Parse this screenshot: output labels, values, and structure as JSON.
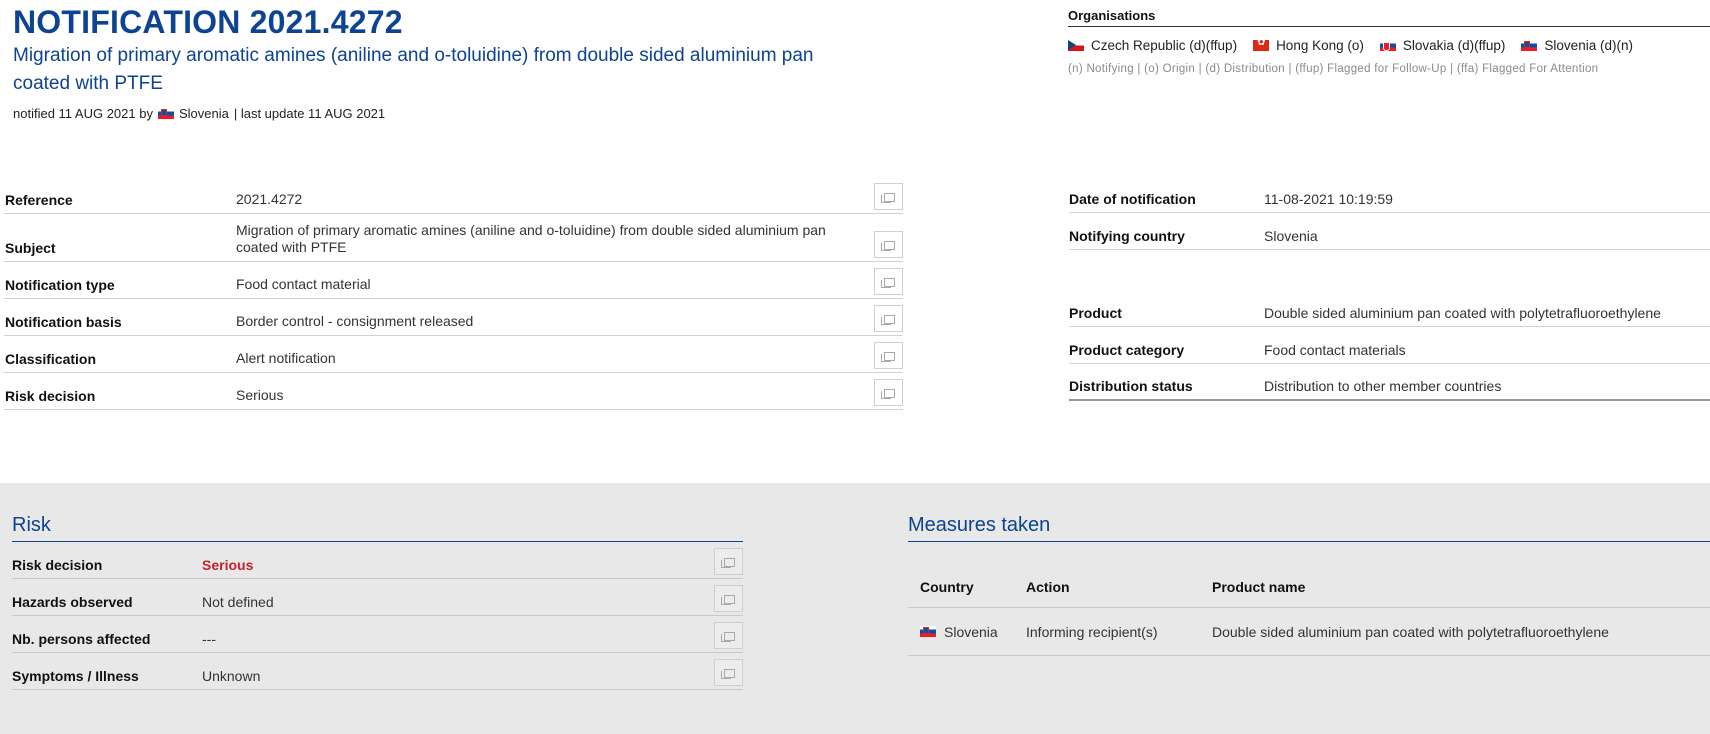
{
  "header": {
    "title": "NOTIFICATION 2021.4272",
    "subtitle": "Migration of primary aromatic amines (aniline and o-toluidine) from double sided aluminium pan coated with PTFE",
    "notified_prefix": "notified 11 AUG 2021 by",
    "notified_country": "Slovenia",
    "last_update": "| last update 11 AUG 2021"
  },
  "organisations": {
    "title": "Organisations",
    "items": [
      {
        "flag": "cz",
        "label": "Czech Republic (d)(ffup)"
      },
      {
        "flag": "hk",
        "label": "Hong Kong (o)"
      },
      {
        "flag": "sk",
        "label": "Slovakia (d)(ffup)"
      },
      {
        "flag": "si",
        "label": "Slovenia (d)(n)"
      }
    ],
    "legend": "(n) Notifying | (o) Origin | (d) Distribution | (ffup) Flagged for Follow-Up | (ffa) Flagged For Attention"
  },
  "details": [
    {
      "label": "Reference",
      "value": "2021.4272"
    },
    {
      "label": "Subject",
      "value": "Migration of primary aromatic amines (aniline and o-toluidine) from double sided aluminium pan coated with PTFE"
    },
    {
      "label": "Notification type",
      "value": "Food contact material"
    },
    {
      "label": "Notification basis",
      "value": "Border control - consignment released"
    },
    {
      "label": "Classification",
      "value": "Alert notification"
    },
    {
      "label": "Risk decision",
      "value": "Serious"
    }
  ],
  "right_details": {
    "date_label": "Date of notification",
    "date_value": "11-08-2021 10:19:59",
    "country_label": "Notifying country",
    "country_value": "Slovenia",
    "product_label": "Product",
    "product_value": "Double sided aluminium pan coated with polytetrafluoroethylene",
    "category_label": "Product category",
    "category_value": "Food contact materials",
    "distribution_label": "Distribution status",
    "distribution_value": "Distribution to other member countries"
  },
  "risk": {
    "title": "Risk",
    "rows": [
      {
        "label": "Risk decision",
        "value": "Serious"
      },
      {
        "label": "Hazards observed",
        "value": "Not defined"
      },
      {
        "label": "Nb. persons affected",
        "value": "---"
      },
      {
        "label": "Symptoms / Illness",
        "value": "Unknown"
      }
    ]
  },
  "measures": {
    "title": "Measures taken",
    "columns": [
      "Country",
      "Action",
      "Product name"
    ],
    "rows": [
      {
        "country": "Slovenia",
        "action": "Informing recipient(s)",
        "product": "Double sided aluminium pan coated with polytetrafluoroethylene"
      }
    ]
  },
  "colors": {
    "brand_blue": "#0d4391",
    "serious_red": "#c0242c",
    "section_bg": "#e8e8e8"
  },
  "icons": {
    "copy": "copy-icon"
  }
}
